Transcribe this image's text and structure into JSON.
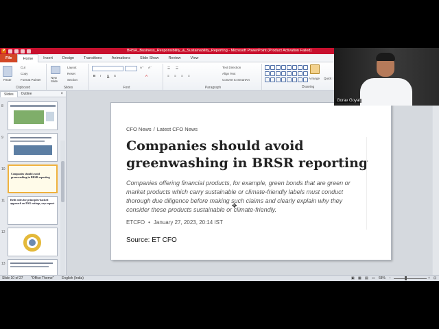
{
  "window": {
    "title": "BRSR_Business_Responsibility_&_Sustainability_Reporting - Microsoft PowerPoint (Product Activation Failed)"
  },
  "ribbon_tabs": [
    "File",
    "Home",
    "Insert",
    "Design",
    "Transitions",
    "Animations",
    "Slide Show",
    "Review",
    "View"
  ],
  "ribbon": {
    "clipboard": {
      "paste": "Paste",
      "cut": "Cut",
      "copy": "Copy",
      "format_painter": "Format Painter",
      "label": "Clipboard"
    },
    "slides": {
      "new_slide": "New Slide",
      "layout": "Layout",
      "reset": "Reset",
      "section": "Section",
      "label": "Slides"
    },
    "font": {
      "label": "Font"
    },
    "paragraph": {
      "text_direction": "Text Direction",
      "align_text": "Align Text",
      "convert_smartart": "Convert to SmartArt",
      "label": "Paragraph"
    },
    "drawing": {
      "arrange": "Arrange",
      "quick_styles": "Quick Styles",
      "label": "Drawing"
    }
  },
  "slides_pane": {
    "tabs": [
      "Slides",
      "Outline"
    ],
    "close": "×",
    "thumbnails": [
      {
        "number": "8",
        "text": ""
      },
      {
        "number": "9",
        "text": ""
      },
      {
        "number": "10",
        "text": "Companies should avoid greenwashing in BRSR reporting"
      },
      {
        "number": "11",
        "text": "Refit rules for principles-backed approach on ESG ratings, says report"
      },
      {
        "number": "12",
        "text": ""
      },
      {
        "number": "13",
        "text": ""
      }
    ]
  },
  "slide": {
    "breadcrumb": [
      "CFO News",
      "Latest CFO News"
    ],
    "breadcrumb_sep": "/",
    "headline": "Companies should avoid greenwashing in BRSR reporting",
    "summary": "Companies offering financial products, for example, green bonds that are green or market products which carry sustainable or climate-friendly labels must conduct thorough due diligence before making such claims and clearly explain why they consider these products sustainable or climate-friendly.",
    "meta_source": "ETCFO",
    "meta_date": "January 27, 2023, 20:14 IST",
    "source": "Source: ET CFO"
  },
  "status": {
    "slide_count": "Slide 10 of 27",
    "theme": "\"Office Theme\"",
    "language": "English (India)",
    "zoom": "68%"
  },
  "webcam": {
    "name": "Gorav Goyal"
  },
  "colors": {
    "title_bar": "#c8102e",
    "file_tab": "#d24726",
    "selected_thumb": "#f0b13c"
  }
}
